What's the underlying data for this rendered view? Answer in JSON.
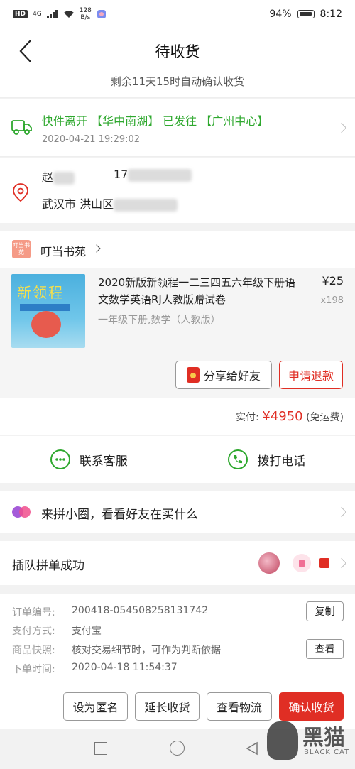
{
  "status_bar": {
    "hd": "HD",
    "network": "4G",
    "speed": "128",
    "speed_unit": "B/s",
    "battery": "94%",
    "time": "8:12"
  },
  "header": {
    "title": "待收货",
    "auto_confirm": "剩余11天15时自动确认收货"
  },
  "logistics": {
    "status": "快件离开 【华中南湖】 已发往 【广州中心】",
    "time": "2020-04-21 19:29:02"
  },
  "address": {
    "name": "赵",
    "phone": "17",
    "line": "武汉市 洪山区"
  },
  "shop": {
    "logo_text": "叮当书苑",
    "name": "叮当书苑"
  },
  "product": {
    "cover_title": "新领程",
    "title": "2020新版新领程一二三四五六年级下册语文数学英语RJ人教版赠试卷",
    "spec": "一年级下册,数学（人教版）",
    "price": "¥25",
    "qty": "x198",
    "share_label": "分享给好友",
    "refund_label": "申请退款"
  },
  "payment": {
    "label": "实付:",
    "amount": "¥4950",
    "note": "(免运费)"
  },
  "contact": {
    "service_label": "联系客服",
    "call_label": "拨打电话"
  },
  "circle": {
    "text": "来拼小圈，看看好友在买什么"
  },
  "group": {
    "text": "插队拼单成功"
  },
  "order_info": {
    "order_no_label": "订单编号:",
    "order_no": "200418-054508258131742",
    "copy_label": "复制",
    "pay_label": "支付方式:",
    "pay_value": "支付宝",
    "snapshot_label": "商品快照:",
    "snapshot_value": "核对交易细节时，可作为判断依据",
    "view_label": "查看",
    "time_label": "下单时间:",
    "time_value": "2020-04-18 11:54:37"
  },
  "actions": {
    "anonymous": "设为匿名",
    "extend": "延长收货",
    "track": "查看物流",
    "confirm": "确认收货"
  },
  "watermark": {
    "text": "黑猫",
    "sub": "BLACK CAT"
  },
  "colors": {
    "accent": "#e02e24",
    "logistics_green": "#2ea82e",
    "circle_purple": "#a55bd9"
  }
}
